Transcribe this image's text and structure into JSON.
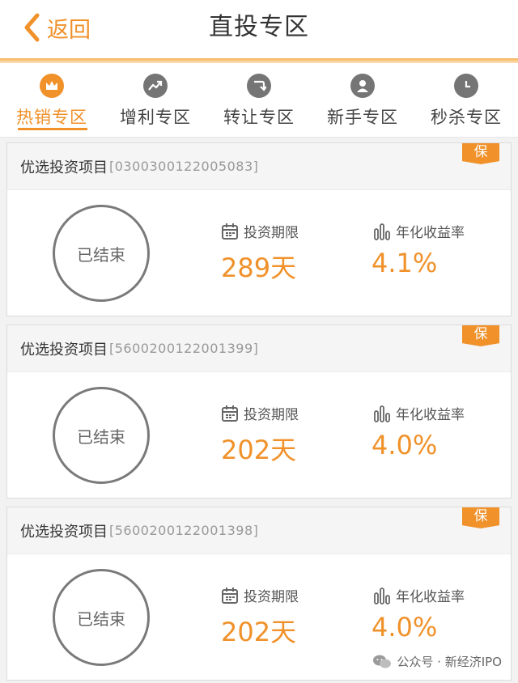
{
  "header": {
    "back_label": "返回",
    "title": "直投专区"
  },
  "tabs": [
    {
      "label": "热销专区",
      "icon": "crown-icon",
      "active": true
    },
    {
      "label": "增利专区",
      "icon": "trend-up-icon",
      "active": false
    },
    {
      "label": "转让专区",
      "icon": "transfer-icon",
      "active": false
    },
    {
      "label": "新手专区",
      "icon": "user-icon",
      "active": false
    },
    {
      "label": "秒杀专区",
      "icon": "clock-icon",
      "active": false
    }
  ],
  "cards": [
    {
      "name": "优选投资项目",
      "code": "[0300300122005083]",
      "badge": "保",
      "status": "已结束",
      "term_label": "投资期限",
      "term_value": "289天",
      "rate_label": "年化收益率",
      "rate_value": "4.1%"
    },
    {
      "name": "优选投资项目",
      "code": "[5600200122001399]",
      "badge": "保",
      "status": "已结束",
      "term_label": "投资期限",
      "term_value": "202天",
      "rate_label": "年化收益率",
      "rate_value": "4.0%"
    },
    {
      "name": "优选投资项目",
      "code": "[5600200122001398]",
      "badge": "保",
      "status": "已结束",
      "term_label": "投资期限",
      "term_value": "202天",
      "rate_label": "年化收益率",
      "rate_value": "4.0%"
    }
  ],
  "watermark": "公众号 · 新经济IPO",
  "colors": {
    "accent": "#f0912a",
    "inactive_icon": "#757575"
  }
}
